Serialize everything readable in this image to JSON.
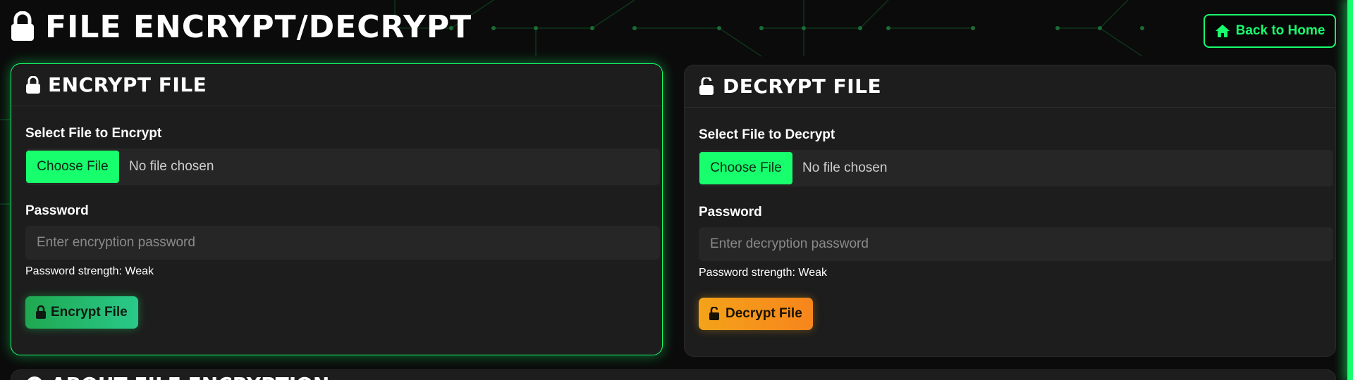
{
  "header": {
    "title": "FILE ENCRYPT/DECRYPT",
    "back_label": "Back to Home"
  },
  "encrypt": {
    "title": "ENCRYPT FILE",
    "file_label": "Select File to Encrypt",
    "choose_label": "Choose File",
    "file_status": "No file chosen",
    "password_label": "Password",
    "password_placeholder": "Enter encryption password",
    "strength_text": "Password strength: Weak",
    "button_label": "Encrypt File"
  },
  "decrypt": {
    "title": "DECRYPT FILE",
    "file_label": "Select File to Decrypt",
    "choose_label": "Choose File",
    "file_status": "No file chosen",
    "password_label": "Password",
    "password_placeholder": "Enter decryption password",
    "strength_text": "Password strength: Weak",
    "button_label": "Decrypt File"
  },
  "about": {
    "title": "ABOUT FILE ENCRYPTION"
  },
  "colors": {
    "accent": "#18ff6d",
    "decrypt_accent": "#f4a31a",
    "background": "#0b0b0b",
    "card": "#1d1d1d"
  },
  "icons": {
    "title": "lock-icon",
    "back": "home-icon",
    "encrypt": "lock-icon",
    "decrypt": "unlock-icon",
    "about": "info-icon"
  }
}
